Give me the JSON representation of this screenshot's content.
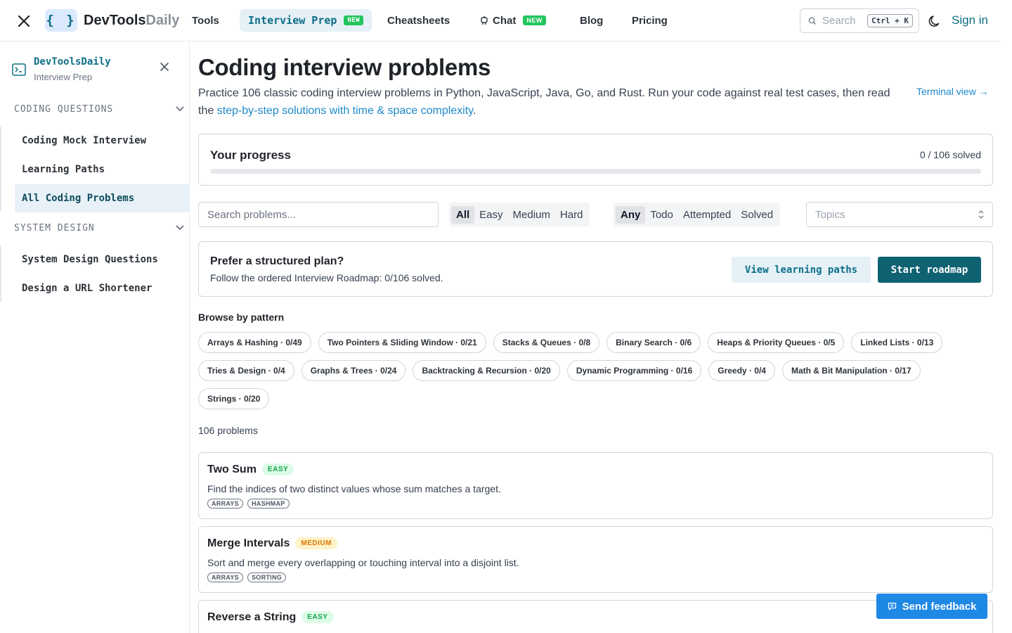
{
  "topnav": {
    "brand_main": "DevTools",
    "brand_accent": "Daily",
    "logo_glyph": "{ }",
    "items": [
      {
        "label": "Tools"
      },
      {
        "label": "Interview Prep",
        "badge": "NEW"
      },
      {
        "label": "Cheatsheets"
      },
      {
        "label": "Chat",
        "badge": "NEW"
      },
      {
        "label": "Blog"
      },
      {
        "label": "Pricing"
      }
    ],
    "search_placeholder": "Search",
    "search_shortcut": "Ctrl + K",
    "signin": "Sign in"
  },
  "sidebar": {
    "title": "DevToolsDaily",
    "subtitle": "Interview Prep",
    "sections": [
      {
        "label": "CODING QUESTIONS",
        "items": [
          "Coding Mock Interview",
          "Learning Paths",
          "All Coding Problems"
        ]
      },
      {
        "label": "SYSTEM DESIGN",
        "items": [
          "System Design Questions",
          "Design a URL Shortener"
        ]
      }
    ]
  },
  "main": {
    "title": "Coding interview problems",
    "intro": "Practice 106 classic coding interview problems in Python, JavaScript, Java, Go, and Rust. Run your code against real test cases, then read the ",
    "intro_link": "step-by-step solutions with time & space complexity",
    "intro_end": ".",
    "terminal_link": "Terminal view →",
    "progress": {
      "title": "Your progress",
      "count": "0 / 106 solved",
      "fraction": 0
    },
    "search_placeholder": "Search problems...",
    "difficulty": [
      "All",
      "Easy",
      "Medium",
      "Hard"
    ],
    "status": [
      "Any",
      "Todo",
      "Attempted",
      "Solved"
    ],
    "topics_placeholder": "Topics",
    "plan": {
      "title": "Prefer a structured plan?",
      "subtitle": "Follow the ordered Interview Roadmap: 0/106 solved.",
      "btn_paths": "View learning paths",
      "btn_roadmap": "Start roadmap"
    },
    "browse_title": "Browse by pattern",
    "patterns": [
      "Arrays & Hashing · 0/49",
      "Two Pointers & Sliding Window · 0/21",
      "Stacks & Queues · 0/8",
      "Binary Search · 0/6",
      "Heaps & Priority Queues · 0/5",
      "Linked Lists · 0/13",
      "Tries & Design · 0/4",
      "Graphs & Trees · 0/24",
      "Backtracking & Recursion · 0/20",
      "Dynamic Programming · 0/16",
      "Greedy · 0/4",
      "Math & Bit Manipulation · 0/17",
      "Strings · 0/20"
    ],
    "problem_count": "106 problems",
    "problems": [
      {
        "title": "Two Sum",
        "difficulty": "EASY",
        "desc": "Find the indices of two distinct values whose sum matches a target.",
        "tags": [
          "ARRAYS",
          "HASHMAP"
        ]
      },
      {
        "title": "Merge Intervals",
        "difficulty": "MEDIUM",
        "desc": "Sort and merge every overlapping or touching interval into a disjoint list.",
        "tags": [
          "ARRAYS",
          "SORTING"
        ]
      },
      {
        "title": "Reverse a String",
        "difficulty": "EASY",
        "desc": "",
        "tags": []
      }
    ]
  },
  "feedback": "Send feedback",
  "colors": {
    "accent": "#0e6f86",
    "link": "#1e88c8",
    "easy": "#16a34a",
    "medium": "#d97706"
  }
}
